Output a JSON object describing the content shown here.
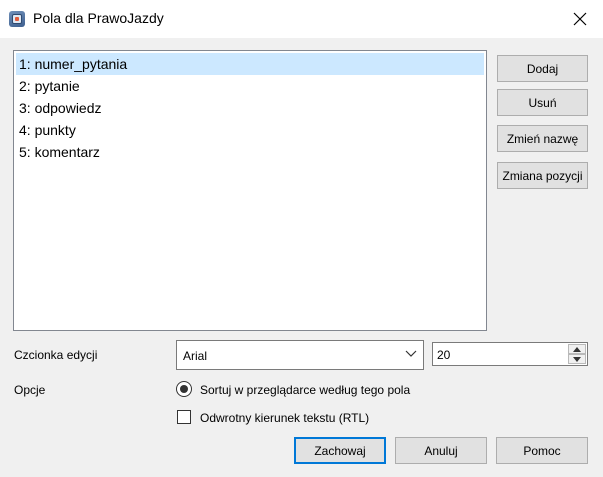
{
  "window": {
    "title": "Pola dla PrawoJazdy"
  },
  "fields": [
    "1: numer_pytania",
    "2: pytanie",
    "3: odpowiedz",
    "4: punkty",
    "5: komentarz"
  ],
  "side_buttons": {
    "add": "Dodaj",
    "delete": "Usuń",
    "rename": "Zmień nazwę",
    "reposition": "Zmiana pozycji"
  },
  "edit_font": {
    "label": "Czcionka edycji",
    "font": "Arial",
    "size": "20"
  },
  "options": {
    "label": "Opcje",
    "sort_label": "Sortuj w przeglądarce według tego pola",
    "rtl_label": "Odwrotny kierunek tekstu (RTL)"
  },
  "footer": {
    "save": "Zachowaj",
    "cancel": "Anuluj",
    "help": "Pomoc"
  }
}
